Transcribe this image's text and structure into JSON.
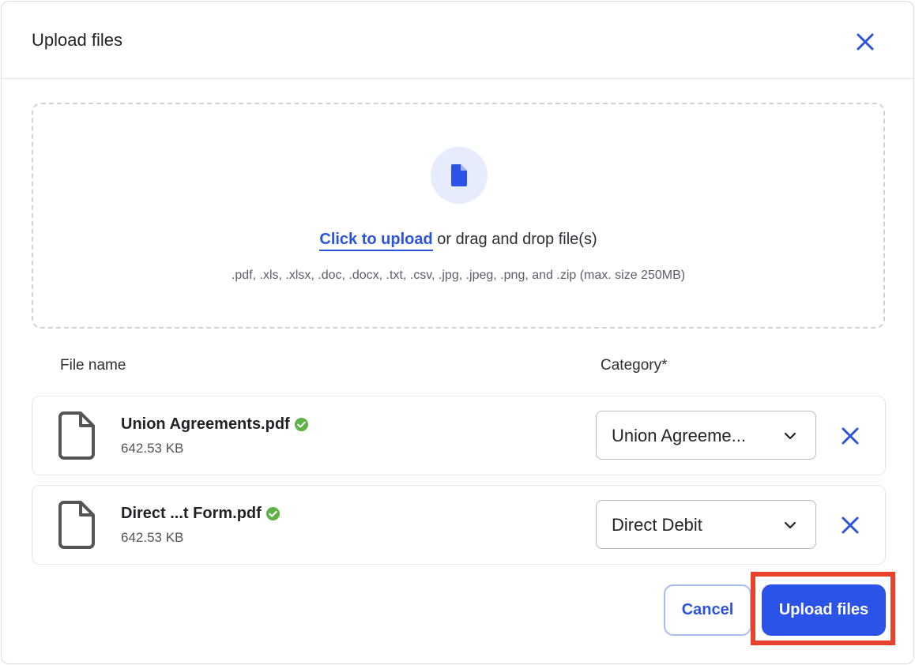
{
  "dialog": {
    "title": "Upload files",
    "close_icon": "close-icon"
  },
  "dropzone": {
    "icon": "file-icon",
    "link_label": "Click to upload",
    "text": " or drag and drop file(s)",
    "formats": ".pdf, .xls, .xlsx, .doc, .docx, .txt, .csv, .jpg, .jpeg, .png, and .zip (max. size 250MB)"
  },
  "table": {
    "col_file_name": "File name",
    "col_category": "Category*"
  },
  "files": [
    {
      "name": "Union Agreements.pdf",
      "size": "642.53 KB",
      "status_icon": "check-circle-icon",
      "category": "Union Agreeme..."
    },
    {
      "name": "Direct ...t Form.pdf",
      "size": "642.53 KB",
      "status_icon": "check-circle-icon",
      "category": "Direct Debit"
    }
  ],
  "actions": {
    "cancel_label": "Cancel",
    "upload_label": "Upload files"
  },
  "colors": {
    "accent": "#2c53e8",
    "link": "#2c53dc",
    "success": "#5fb346",
    "highlight": "#e8412c"
  }
}
